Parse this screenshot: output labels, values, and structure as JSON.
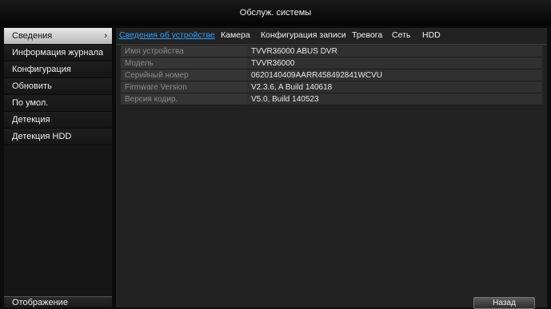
{
  "window": {
    "title": "Обслуж. системы"
  },
  "sidebar": {
    "items": [
      {
        "label": "Сведения",
        "active": true
      },
      {
        "label": "Информация журнала"
      },
      {
        "label": "Конфигурация"
      },
      {
        "label": "Обновить"
      },
      {
        "label": "По умол."
      },
      {
        "label": "Детекция"
      },
      {
        "label": "Детекция HDD"
      }
    ],
    "bottom_label": "Отображение",
    "active_chevron": "›"
  },
  "tabs": [
    {
      "label": "Сведения об устройстве",
      "active": true
    },
    {
      "label": "Камера"
    },
    {
      "label": "Конфигурация записи"
    },
    {
      "label": "Тревога"
    },
    {
      "label": "Сеть"
    },
    {
      "label": "HDD"
    }
  ],
  "device_info": [
    {
      "label": "Имя устройства",
      "value": "TVVR36000 ABUS DVR"
    },
    {
      "label": "Модель",
      "value": "TVVR36000"
    },
    {
      "label": "Серийный номер",
      "value": "0620140409AARR458492841WCVU"
    },
    {
      "label": "Firmware Version",
      "value": "V2.3.6, A Build 140618"
    },
    {
      "label": "Версия кодир.",
      "value": "V5.0, Build 140523"
    }
  ],
  "buttons": {
    "back_label": "Назад"
  },
  "colors": {
    "accent": "#2aa0ff",
    "background": "#222222",
    "active_item": "#d0d0d0"
  }
}
